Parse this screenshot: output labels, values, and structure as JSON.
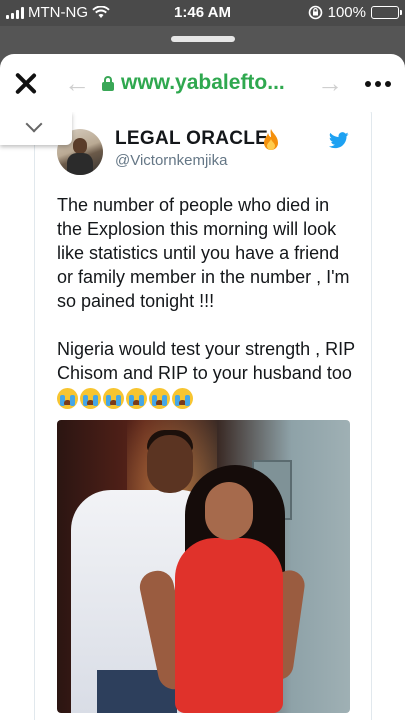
{
  "status_bar": {
    "carrier": "MTN-NG",
    "time": "1:46 AM",
    "battery_percent": "100%",
    "battery_level": 1.0,
    "icons": [
      "signal-icon",
      "wifi-icon",
      "rotation-lock-icon",
      "battery-icon"
    ]
  },
  "browser": {
    "url": "www.yabaleftо...",
    "icons": [
      "close-icon",
      "back-arrow-icon",
      "lock-icon",
      "forward-arrow-icon",
      "more-icon",
      "chevron-down-icon"
    ]
  },
  "tweet": {
    "display_name": "LEGAL ORACLE",
    "handle": "@Victornkemjika",
    "paragraph1": "The number of people who died in the Explosion this morning will look like statistics until you have a friend or family member in the number , I'm so pained tonight !!!",
    "paragraph2": "Nigeria would test your strength , RIP Chisom and RIP to your husband too",
    "emoji_count": 6,
    "icons": [
      "fire-emoji-icon",
      "twitter-bird-icon",
      "crying-face-emoji-icon"
    ]
  },
  "colors": {
    "url_green": "#2fa84f",
    "twitter_blue": "#1da1f2",
    "battery_green": "#4cd964",
    "status_bar_bg": "#4a4a4a"
  }
}
